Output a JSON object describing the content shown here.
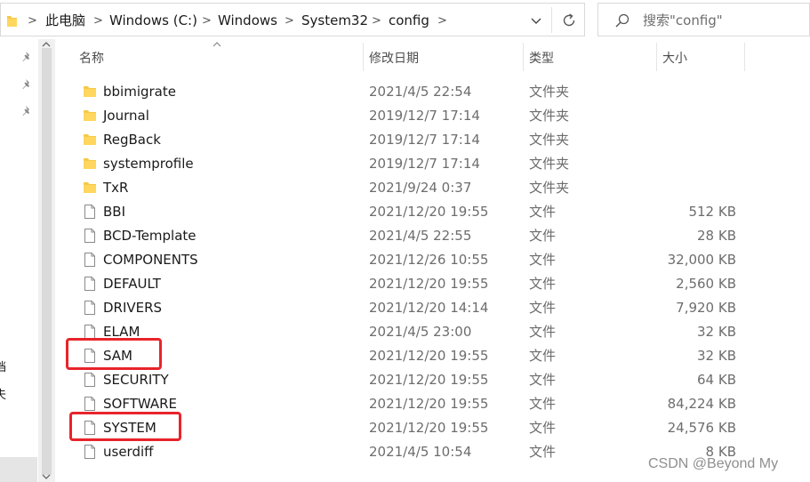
{
  "address_bar": {
    "crumbs": [
      "此电脑",
      "Windows (C:)",
      "Windows",
      "System32",
      "config"
    ]
  },
  "search": {
    "placeholder": "搜索\"config\""
  },
  "nav_pane": {
    "fragments": [
      "档",
      "夫"
    ]
  },
  "columns": {
    "name": "名称",
    "date": "修改日期",
    "type": "类型",
    "size": "大小"
  },
  "files": [
    {
      "name": "bbimigrate",
      "date": "2021/4/5 22:54",
      "type": "文件夹",
      "size": "",
      "kind": "folder"
    },
    {
      "name": "Journal",
      "date": "2019/12/7 17:14",
      "type": "文件夹",
      "size": "",
      "kind": "folder"
    },
    {
      "name": "RegBack",
      "date": "2019/12/7 17:14",
      "type": "文件夹",
      "size": "",
      "kind": "folder"
    },
    {
      "name": "systemprofile",
      "date": "2019/12/7 17:14",
      "type": "文件夹",
      "size": "",
      "kind": "folder"
    },
    {
      "name": "TxR",
      "date": "2021/9/24 0:37",
      "type": "文件夹",
      "size": "",
      "kind": "folder"
    },
    {
      "name": "BBI",
      "date": "2021/12/20 19:55",
      "type": "文件",
      "size": "512 KB",
      "kind": "file"
    },
    {
      "name": "BCD-Template",
      "date": "2021/4/5 22:55",
      "type": "文件",
      "size": "28 KB",
      "kind": "file"
    },
    {
      "name": "COMPONENTS",
      "date": "2021/12/26 10:55",
      "type": "文件",
      "size": "32,000 KB",
      "kind": "file"
    },
    {
      "name": "DEFAULT",
      "date": "2021/12/20 19:55",
      "type": "文件",
      "size": "2,560 KB",
      "kind": "file"
    },
    {
      "name": "DRIVERS",
      "date": "2021/12/20 14:14",
      "type": "文件",
      "size": "7,920 KB",
      "kind": "file"
    },
    {
      "name": "ELAM",
      "date": "2021/4/5 23:00",
      "type": "文件",
      "size": "32 KB",
      "kind": "file"
    },
    {
      "name": "SAM",
      "date": "2021/12/20 19:55",
      "type": "文件",
      "size": "32 KB",
      "kind": "file"
    },
    {
      "name": "SECURITY",
      "date": "2021/12/20 19:55",
      "type": "文件",
      "size": "64 KB",
      "kind": "file"
    },
    {
      "name": "SOFTWARE",
      "date": "2021/12/20 19:55",
      "type": "文件",
      "size": "84,224 KB",
      "kind": "file"
    },
    {
      "name": "SYSTEM",
      "date": "2021/12/20 19:55",
      "type": "文件",
      "size": "24,576 KB",
      "kind": "file"
    },
    {
      "name": "userdiff",
      "date": "2021/4/5 10:54",
      "type": "文件",
      "size": "8 KB",
      "kind": "file"
    }
  ],
  "watermark": "CSDN @Beyond My",
  "colors": {
    "folder_icon": "#f7c948",
    "highlight_border": "#e8242b",
    "selection": "#e5e5e5"
  }
}
